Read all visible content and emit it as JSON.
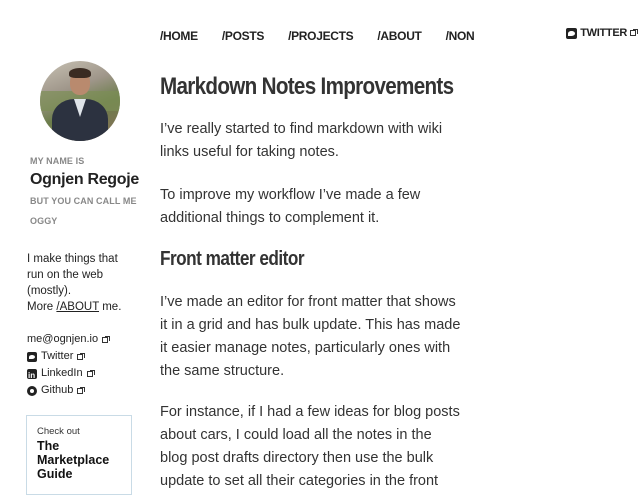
{
  "nav": {
    "items": [
      "/HOME",
      "/POSTS",
      "/PROJECTS",
      "/ABOUT",
      "/NON"
    ],
    "twitter_label": "TWITTER"
  },
  "sidebar": {
    "my_name_is": "MY NAME IS",
    "name": "Ognjen Regoje",
    "call_me_line1": "BUT YOU CAN CALL ME",
    "call_me_line2": "OGGY",
    "bio_line1": "I make things that",
    "bio_line2": "run on the web",
    "bio_line3": "(mostly).",
    "bio_more": "More",
    "bio_link": "/ABOUT",
    "bio_end": "me.",
    "links": {
      "email": "me@ognjen.io",
      "twitter": "Twitter",
      "linkedin": "LinkedIn",
      "github": "Github"
    },
    "promo": {
      "small": "Check out",
      "line1": "The",
      "line2": "Marketplace",
      "line3": "Guide"
    }
  },
  "article": {
    "title": "Markdown Notes Improvements",
    "p1_line1": "I’ve really started to find markdown with wiki",
    "p1_line2": "links useful for taking notes.",
    "p2_line1": "To improve my workflow I’ve made a few",
    "p2_line2": "additional things to complement it.",
    "h2": "Front matter editor",
    "p3_line1": "I’ve made an editor for front matter that shows",
    "p3_line2": "it in a grid and has bulk update. This has made",
    "p3_line3": "it easier manage notes, particularly ones with",
    "p3_line4": "the same structure.",
    "p4_line1": "For instance, if I had a few ideas for blog posts",
    "p4_line2": "about cars, I could load all the notes in the",
    "p4_line3": "blog post drafts directory then use the bulk",
    "p4_line4": "update to set all their categories in the front"
  },
  "icons": {
    "twitter": "twitter-icon",
    "external": "external-link-icon",
    "linkedin": "linkedin-icon",
    "github": "github-icon"
  }
}
